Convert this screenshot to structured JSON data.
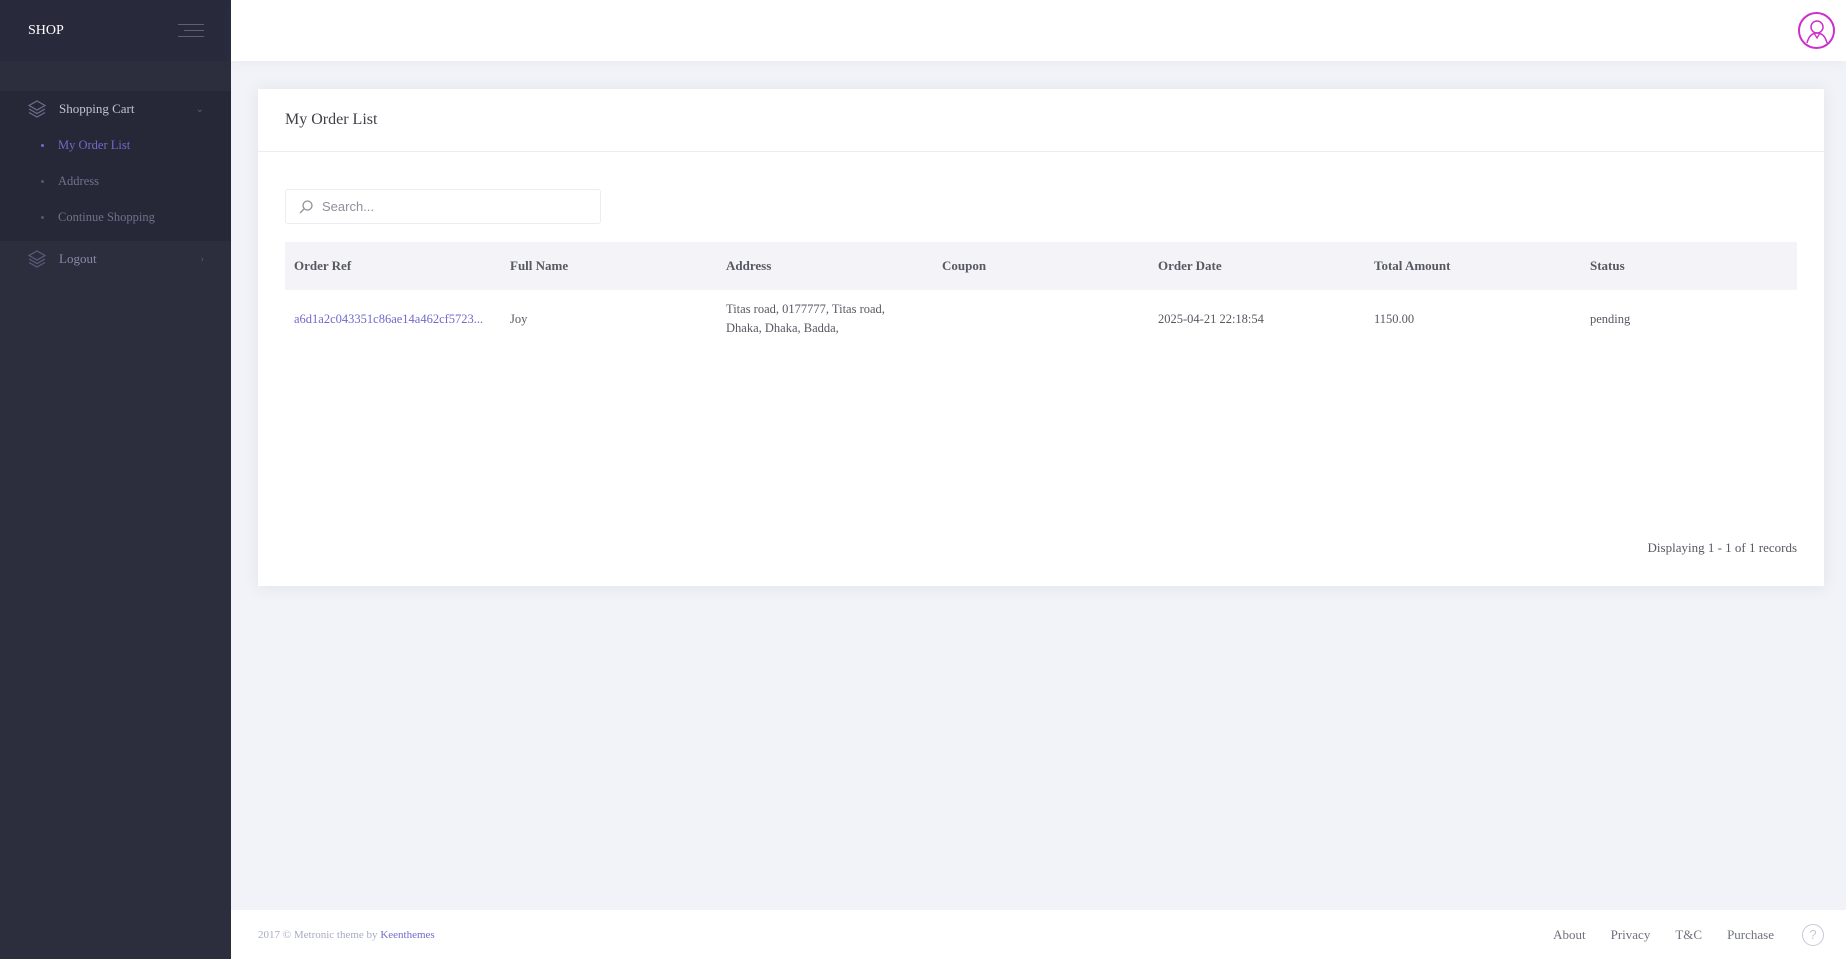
{
  "brand": {
    "name": "SHOP"
  },
  "sidebar": {
    "menu": [
      {
        "label": "Shopping Cart",
        "icon": "layers-icon",
        "arrow": "⌄"
      },
      {
        "label": "Logout",
        "icon": "layers-icon",
        "arrow": "›"
      }
    ],
    "submenu": [
      {
        "label": "My Order List",
        "active": true
      },
      {
        "label": "Address",
        "active": false
      },
      {
        "label": "Continue Shopping",
        "active": false
      }
    ]
  },
  "header": {
    "avatar_icon": "user-avatar-icon"
  },
  "portlet": {
    "title": "My Order List",
    "search": {
      "placeholder": "Search...",
      "value": ""
    },
    "table": {
      "columns": [
        "Order Ref",
        "Full Name",
        "Address",
        "Coupon",
        "Order Date",
        "Total Amount",
        "Status"
      ],
      "rows": [
        {
          "order_ref": "a6d1a2c043351c86ae14a462cf5723...",
          "full_name": "Joy",
          "address_line1": "Titas road, 0177777, Titas road,",
          "address_line2": "Dhaka, Dhaka, Badda,",
          "coupon": "",
          "order_date": "2025-04-21 22:18:54",
          "total_amount": "1150.00",
          "status": "pending"
        }
      ]
    },
    "records": "Displaying 1 - 1 of 1 records"
  },
  "footer": {
    "copyright": "2017 © Metronic theme by ",
    "author": "Keenthemes",
    "links": [
      "About",
      "Privacy",
      "T&C",
      "Purchase"
    ],
    "help": "?"
  },
  "colors": {
    "accent": "#716aca",
    "sidebar_bg": "#2c2e3e",
    "avatar_ring": "#cc2fcc"
  }
}
